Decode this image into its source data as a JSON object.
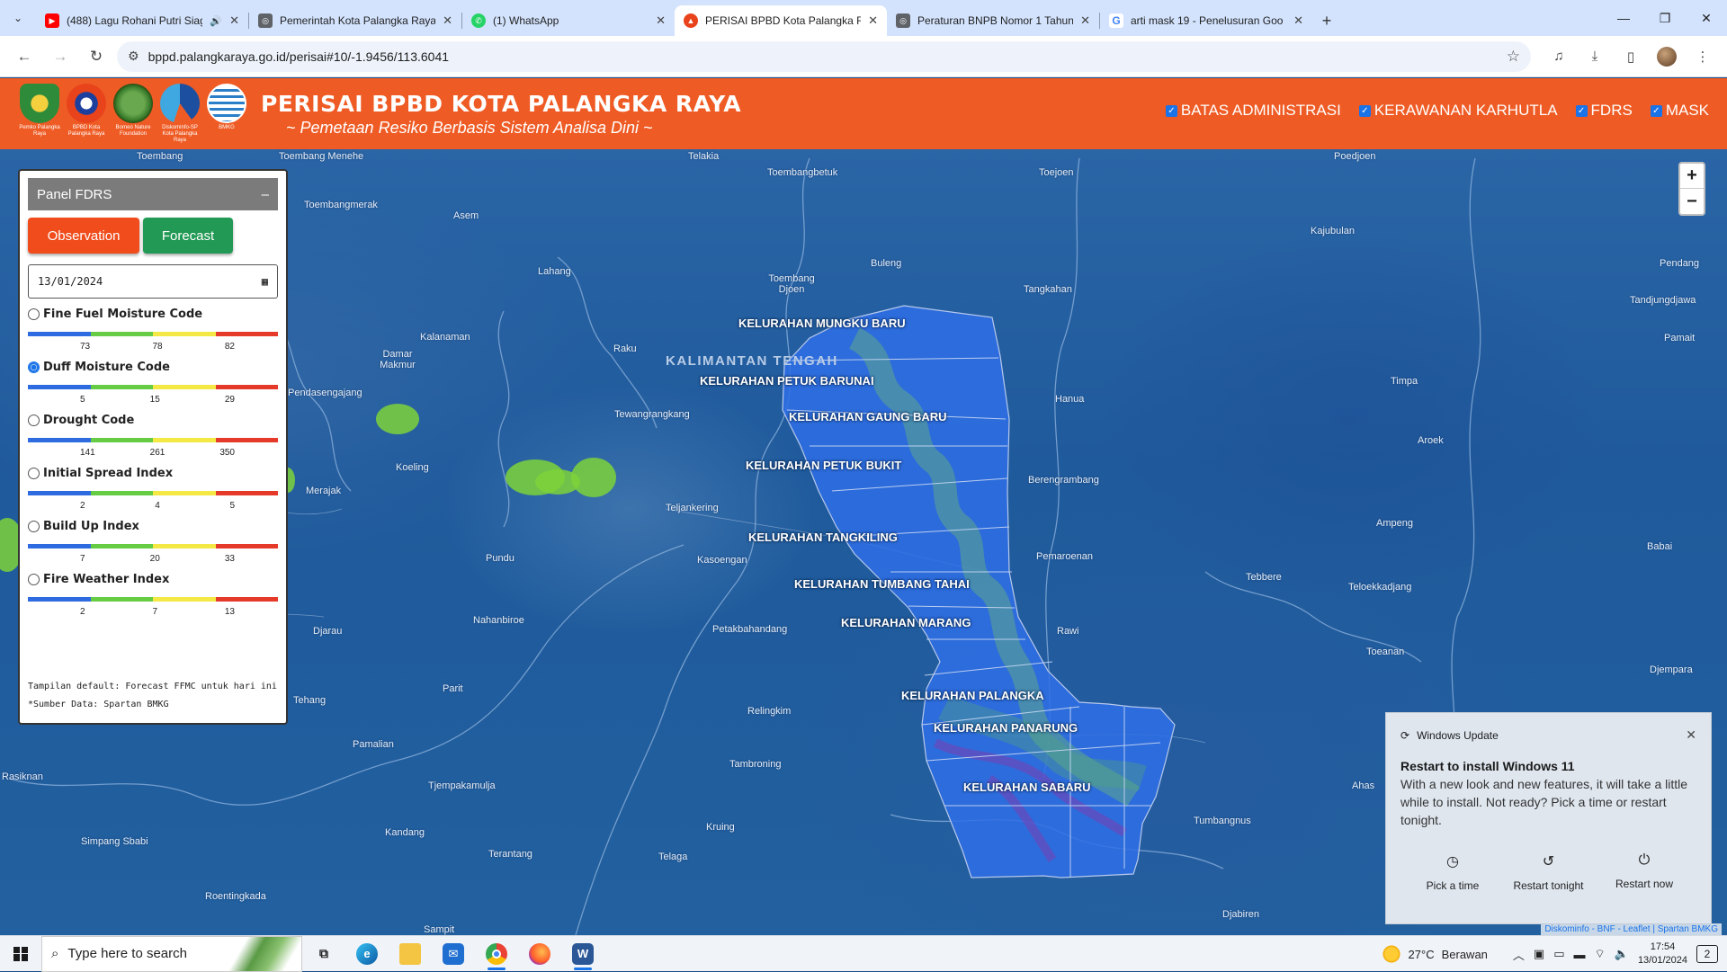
{
  "browser": {
    "tabs": [
      {
        "title": "(488) Lagu Rohani Putri Siag",
        "icon": "youtube-icon",
        "color": "#ff0000",
        "audio": true,
        "active": false
      },
      {
        "title": "Pemerintah Kota Palangka Raya",
        "icon": "globe-icon",
        "color": "#5f6368",
        "audio": false,
        "active": false
      },
      {
        "title": "(1) WhatsApp",
        "icon": "whatsapp-icon",
        "color": "#25d366",
        "audio": false,
        "active": false
      },
      {
        "title": "PERISAI BPBD Kota Palangka Ra",
        "icon": "bpbd-icon",
        "color": "#e8431b",
        "audio": false,
        "active": true
      },
      {
        "title": "Peraturan BNPB Nomor 1 Tahun",
        "icon": "globe-icon",
        "color": "#5f6368",
        "audio": false,
        "active": false
      },
      {
        "title": "arti mask 19 - Penelusuran Goo",
        "icon": "google-icon",
        "color": "#4285f4",
        "audio": false,
        "active": false
      }
    ],
    "url": "bppd.palangkaraya.go.id/perisai#10/-1.9456/113.6041"
  },
  "header": {
    "title": "PERISAI BPBD KOTA PALANGKA RAYA",
    "subtitle": "~ Pemetaan Resiko Berbasis Sistem Analisa Dini ~",
    "logos": [
      {
        "caption": "Pemko Palangka Raya",
        "color": "#2e8b3a"
      },
      {
        "caption": "BPBD Kota Palangka Raya",
        "color": "#e8431b"
      },
      {
        "caption": "Borneo Nature Foundation",
        "color": "#3a7d2c"
      },
      {
        "caption": "Diskominfo-SP Kota Palangka Raya",
        "color": "#1c4fa0"
      },
      {
        "caption": "BMKG",
        "color": "#2a7fc8"
      }
    ],
    "layers": [
      {
        "label": "BATAS ADMINISTRASI",
        "checked": true
      },
      {
        "label": "KERAWANAN KARHUTLA",
        "checked": true
      },
      {
        "label": "FDRS",
        "checked": true
      },
      {
        "label": "MASK",
        "checked": true
      }
    ]
  },
  "panel": {
    "title": "Panel FDRS",
    "collapse": "–",
    "observation_label": "Observation",
    "forecast_label": "Forecast",
    "date": "13/01/2024",
    "indices": [
      {
        "name": "Fine Fuel Moisture Code",
        "ticks": [
          "73",
          "78",
          "82"
        ],
        "selected": false
      },
      {
        "name": "Duff Moisture Code",
        "ticks": [
          "5",
          "15",
          "29"
        ],
        "selected": true
      },
      {
        "name": "Drought Code",
        "ticks": [
          "141",
          "261",
          "350"
        ],
        "selected": false
      },
      {
        "name": "Initial Spread Index",
        "ticks": [
          "2",
          "4",
          "5"
        ],
        "selected": false
      },
      {
        "name": "Build Up Index",
        "ticks": [
          "7",
          "20",
          "33"
        ],
        "selected": false
      },
      {
        "name": "Fire Weather Index",
        "ticks": [
          "2",
          "7",
          "13"
        ],
        "selected": false
      }
    ],
    "scale_colors": [
      "#2f6be0",
      "#66cc44",
      "#f3e844",
      "#e53a2a"
    ],
    "footnote_1": "Tampilan default: Forecast FFMC untuk hari ini",
    "footnote_2": "*Sumber Data: Spartan BMKG"
  },
  "map": {
    "province": "KALIMANTAN TENGAH",
    "zoom_in": "+",
    "zoom_out": "−",
    "attribution": "Diskominfo - BNF - Leaflet | Spartan BMKG",
    "places": [
      "Toembang",
      "Toembang Menehe",
      "Telakia",
      "Toembangbetuk",
      "Toejoen",
      "Poedjoen",
      "Toembangmerak",
      "Asem",
      "Kajubulan",
      "Buleng",
      "Pendang",
      "Lahang",
      "Toembang Djoen",
      "Tangkahan",
      "Tandjungdjawa",
      "Kalanaman",
      "Damar Makmur",
      "Raku",
      "Pamait",
      "Pendasengajang",
      "Tewangrangkang",
      "Timpa",
      "Hanua",
      "Aroek",
      "Koeling",
      "Berengrambang",
      "Merajak",
      "Teljankering",
      "Ampeng",
      "Kasoengan",
      "Pemaroenan",
      "Babai",
      "Pundu",
      "Tebbere",
      "Teloekkadjang",
      "Nahanbiroe",
      "Djarau",
      "Petakbahandang",
      "Rawi",
      "Toeanan",
      "Djempara",
      "Parit",
      "Tehang",
      "Relingkim",
      "Pamalian",
      "Tambroning",
      "Ahas",
      "Tjempakamulja",
      "Rasiknan",
      "Kandang",
      "Kruing",
      "Tumbangnus",
      "Simpang Sbabi",
      "Terantang",
      "Telaga",
      "Roentingkada",
      "Djabiren",
      "Sampit"
    ],
    "kelurahan": [
      "KELURAHAN MUNGKU BARU",
      "KELURAHAN PETUK BARUNAI",
      "KELURAHAN GAUNG BARU",
      "KELURAHAN PETUK BUKIT",
      "KELURAHAN TANGKILING",
      "KELURAHAN TUMBANG TAHAI",
      "KELURAHAN MARANG",
      "KELURAHAN PALANGKA",
      "KELURAHAN PANARUNG",
      "KELURAHAN SABARU"
    ]
  },
  "toast": {
    "app": "Windows Update",
    "title": "Restart to install Windows 11",
    "body": "With a new look and new features, it will take a little while to install. Not ready? Pick a time or restart tonight.",
    "actions": [
      "Pick a time",
      "Restart tonight",
      "Restart now"
    ]
  },
  "taskbar": {
    "search_placeholder": "Type here to search",
    "weather_temp": "27°C",
    "weather_desc": "Berawan",
    "time": "17:54",
    "date": "13/01/2024",
    "notif_count": "2"
  }
}
